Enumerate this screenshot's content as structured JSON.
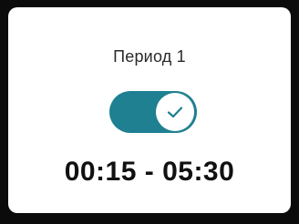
{
  "period": {
    "title": "Период 1",
    "time_range": "00:15 - 05:30"
  },
  "toggle": {
    "state": "on",
    "icon": "check-icon"
  },
  "colors": {
    "background": "#0b0b0b",
    "card": "#ffffff",
    "toggle_track": "#1e8090",
    "toggle_knob": "#ffffff",
    "text": "#111111"
  }
}
